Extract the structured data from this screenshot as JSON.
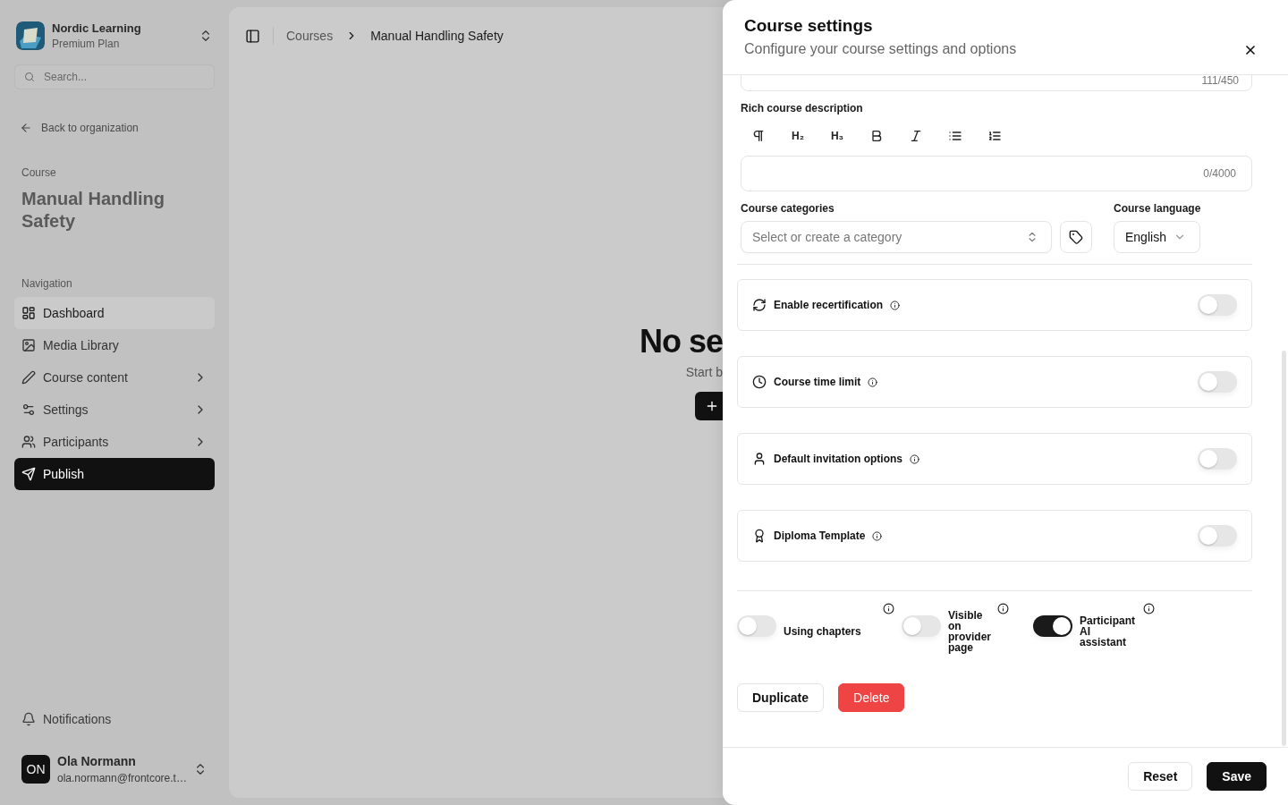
{
  "sidebar": {
    "org": {
      "name": "Nordic Learning",
      "plan": "Premium Plan"
    },
    "search": {
      "placeholder": "Search..."
    },
    "back_link": "Back to organization",
    "course_label": "Course",
    "course_title": "Manual Handling Safety",
    "nav_heading": "Navigation",
    "nav_items": [
      {
        "label": "Dashboard",
        "kind": "dashboard",
        "selected": false,
        "hovered": true,
        "has_submenu": false
      },
      {
        "label": "Media Library",
        "kind": "media",
        "selected": false,
        "hovered": false,
        "has_submenu": false
      },
      {
        "label": "Course content",
        "kind": "content",
        "selected": false,
        "hovered": false,
        "has_submenu": true
      },
      {
        "label": "Settings",
        "kind": "settings",
        "selected": false,
        "hovered": false,
        "has_submenu": true
      },
      {
        "label": "Participants",
        "kind": "participants",
        "selected": false,
        "hovered": false,
        "has_submenu": true
      },
      {
        "label": "Publish",
        "kind": "publish",
        "selected": true,
        "hovered": false,
        "has_submenu": false
      }
    ],
    "notifications": "Notifications",
    "user": {
      "initials": "ON",
      "name": "Ola Normann",
      "email": "ola.normann@frontcore.t…"
    }
  },
  "main": {
    "breadcrumbs": [
      {
        "label": "Courses",
        "current": false
      },
      {
        "label": "Manual Handling Safety",
        "current": true
      }
    ],
    "empty_state": {
      "title": "No se",
      "subtitle": "Start b"
    }
  },
  "sheet": {
    "title": "Course settings",
    "subtitle": "Configure your course settings and options",
    "short_description": {
      "counter": "111/450"
    },
    "rich_description": {
      "label": "Rich course description",
      "counter": "0/4000",
      "toolbar": [
        {
          "kind": "paragraph"
        },
        {
          "kind": "heading",
          "label": "H₂"
        },
        {
          "kind": "heading",
          "label": "H₃"
        },
        {
          "kind": "bold"
        },
        {
          "kind": "italic"
        },
        {
          "kind": "bullet-list"
        },
        {
          "kind": "ordered-list"
        }
      ]
    },
    "categories": {
      "label": "Course categories",
      "placeholder": "Select or create a category"
    },
    "language": {
      "label": "Course language",
      "value": "English"
    },
    "feature_toggles": [
      {
        "label": "Enable recertification",
        "kind": "recertification",
        "on": false
      },
      {
        "label": "Course time limit",
        "kind": "time-limit",
        "on": false
      },
      {
        "label": "Default invitation options",
        "kind": "invitation",
        "on": false
      },
      {
        "label": "Diploma Template",
        "kind": "diploma",
        "on": false
      }
    ],
    "options": [
      {
        "label": "Using chapters",
        "on": false
      },
      {
        "label": "Visible on provider page",
        "on": false
      },
      {
        "label": "Participant AI assistant",
        "on": true
      }
    ],
    "actions": [
      {
        "label": "Duplicate",
        "kind": "outline"
      },
      {
        "label": "Delete",
        "kind": "danger"
      }
    ],
    "footer": [
      {
        "label": "Reset",
        "kind": "outline"
      },
      {
        "label": "Save",
        "kind": "primary"
      }
    ]
  }
}
